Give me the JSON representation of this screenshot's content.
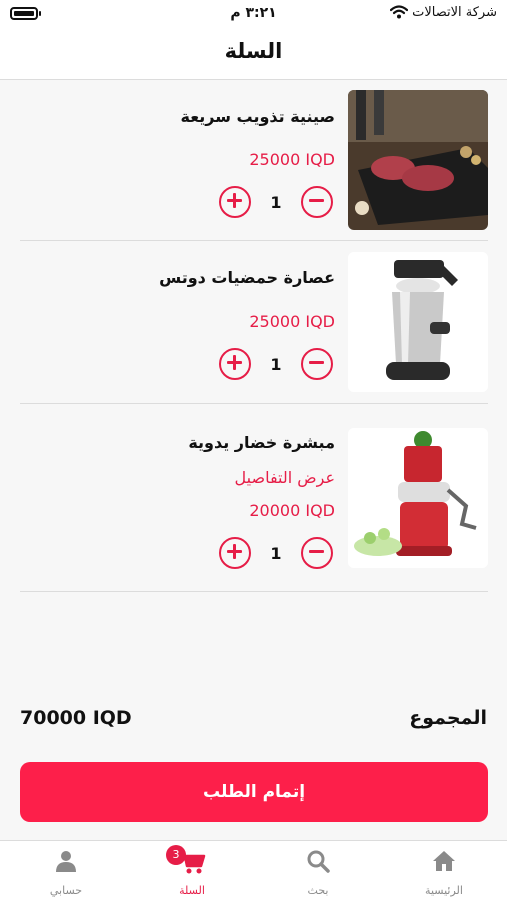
{
  "status_bar": {
    "carrier": "شركة الاتصالات",
    "time": "٣:٢١ م"
  },
  "header": {
    "title": "السلة"
  },
  "cart_items": [
    {
      "name": "صينية تذويب سريعة",
      "details_link": "",
      "price": "25000 IQD",
      "quantity": "1",
      "image_icon": "meat-tray-photo"
    },
    {
      "name": "عصارة حمضيات دوتس",
      "details_link": "",
      "price": "25000 IQD",
      "quantity": "1",
      "image_icon": "citrus-juicer-photo"
    },
    {
      "name": "مبشرة خضار يدوية",
      "details_link": "عرض التفاصيل",
      "price": "20000 IQD",
      "quantity": "1",
      "image_icon": "vegetable-grater-photo"
    }
  ],
  "summary": {
    "total_label": "المجموع",
    "total_value": "70000 IQD"
  },
  "checkout": {
    "label": "إتمام الطلب"
  },
  "tabbar": {
    "tabs": [
      {
        "label": "الرئيسية",
        "icon": "home-icon"
      },
      {
        "label": "بحث",
        "icon": "search-icon"
      },
      {
        "label": "السلة",
        "icon": "cart-icon",
        "badge": "3",
        "active": true
      },
      {
        "label": "حسابي",
        "icon": "user-icon"
      }
    ]
  },
  "colors": {
    "accent": "#e61d47",
    "button": "#fd1f4a",
    "inactive": "#8a8a8a",
    "background": "#f7f7f7"
  }
}
